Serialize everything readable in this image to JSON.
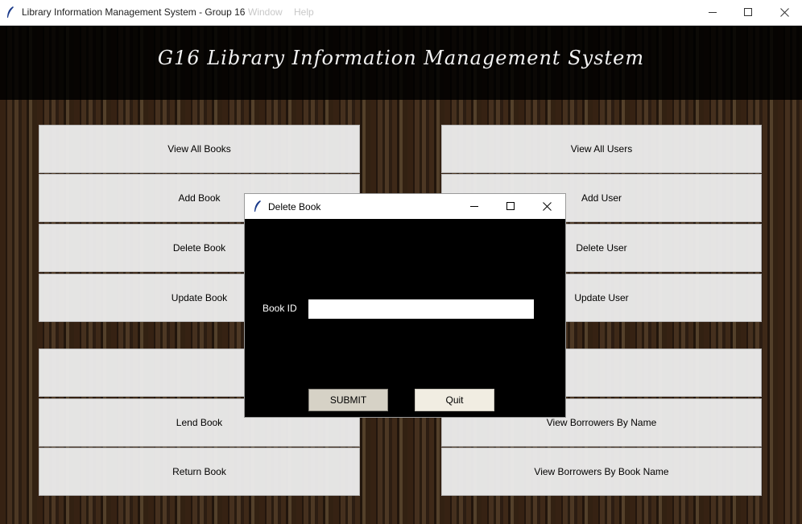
{
  "window": {
    "title": "Library Information Management System - Group 16",
    "ghost_menu": [
      "Window",
      "Help"
    ]
  },
  "banner": {
    "text": "G16 Library Information Management System"
  },
  "buttons_left": [
    "View All Books",
    "Add Book",
    "Delete Book",
    "Update Book",
    "",
    "Lend Book",
    "Return Book"
  ],
  "buttons_right": [
    "View All Users",
    "Add User",
    "Delete User",
    "Update User",
    "",
    "View Borrowers By Name",
    "View Borrowers By Book Name"
  ],
  "dialog": {
    "title": "Delete Book",
    "field_label": "Book ID",
    "field_value": "",
    "submit_label": "SUBMIT",
    "quit_label": "Quit"
  },
  "colors": {
    "button_bg": "#ececec",
    "submit_bg": "#d6d2c6",
    "quit_bg": "#f1ede2",
    "dialog_bg": "#000000"
  }
}
